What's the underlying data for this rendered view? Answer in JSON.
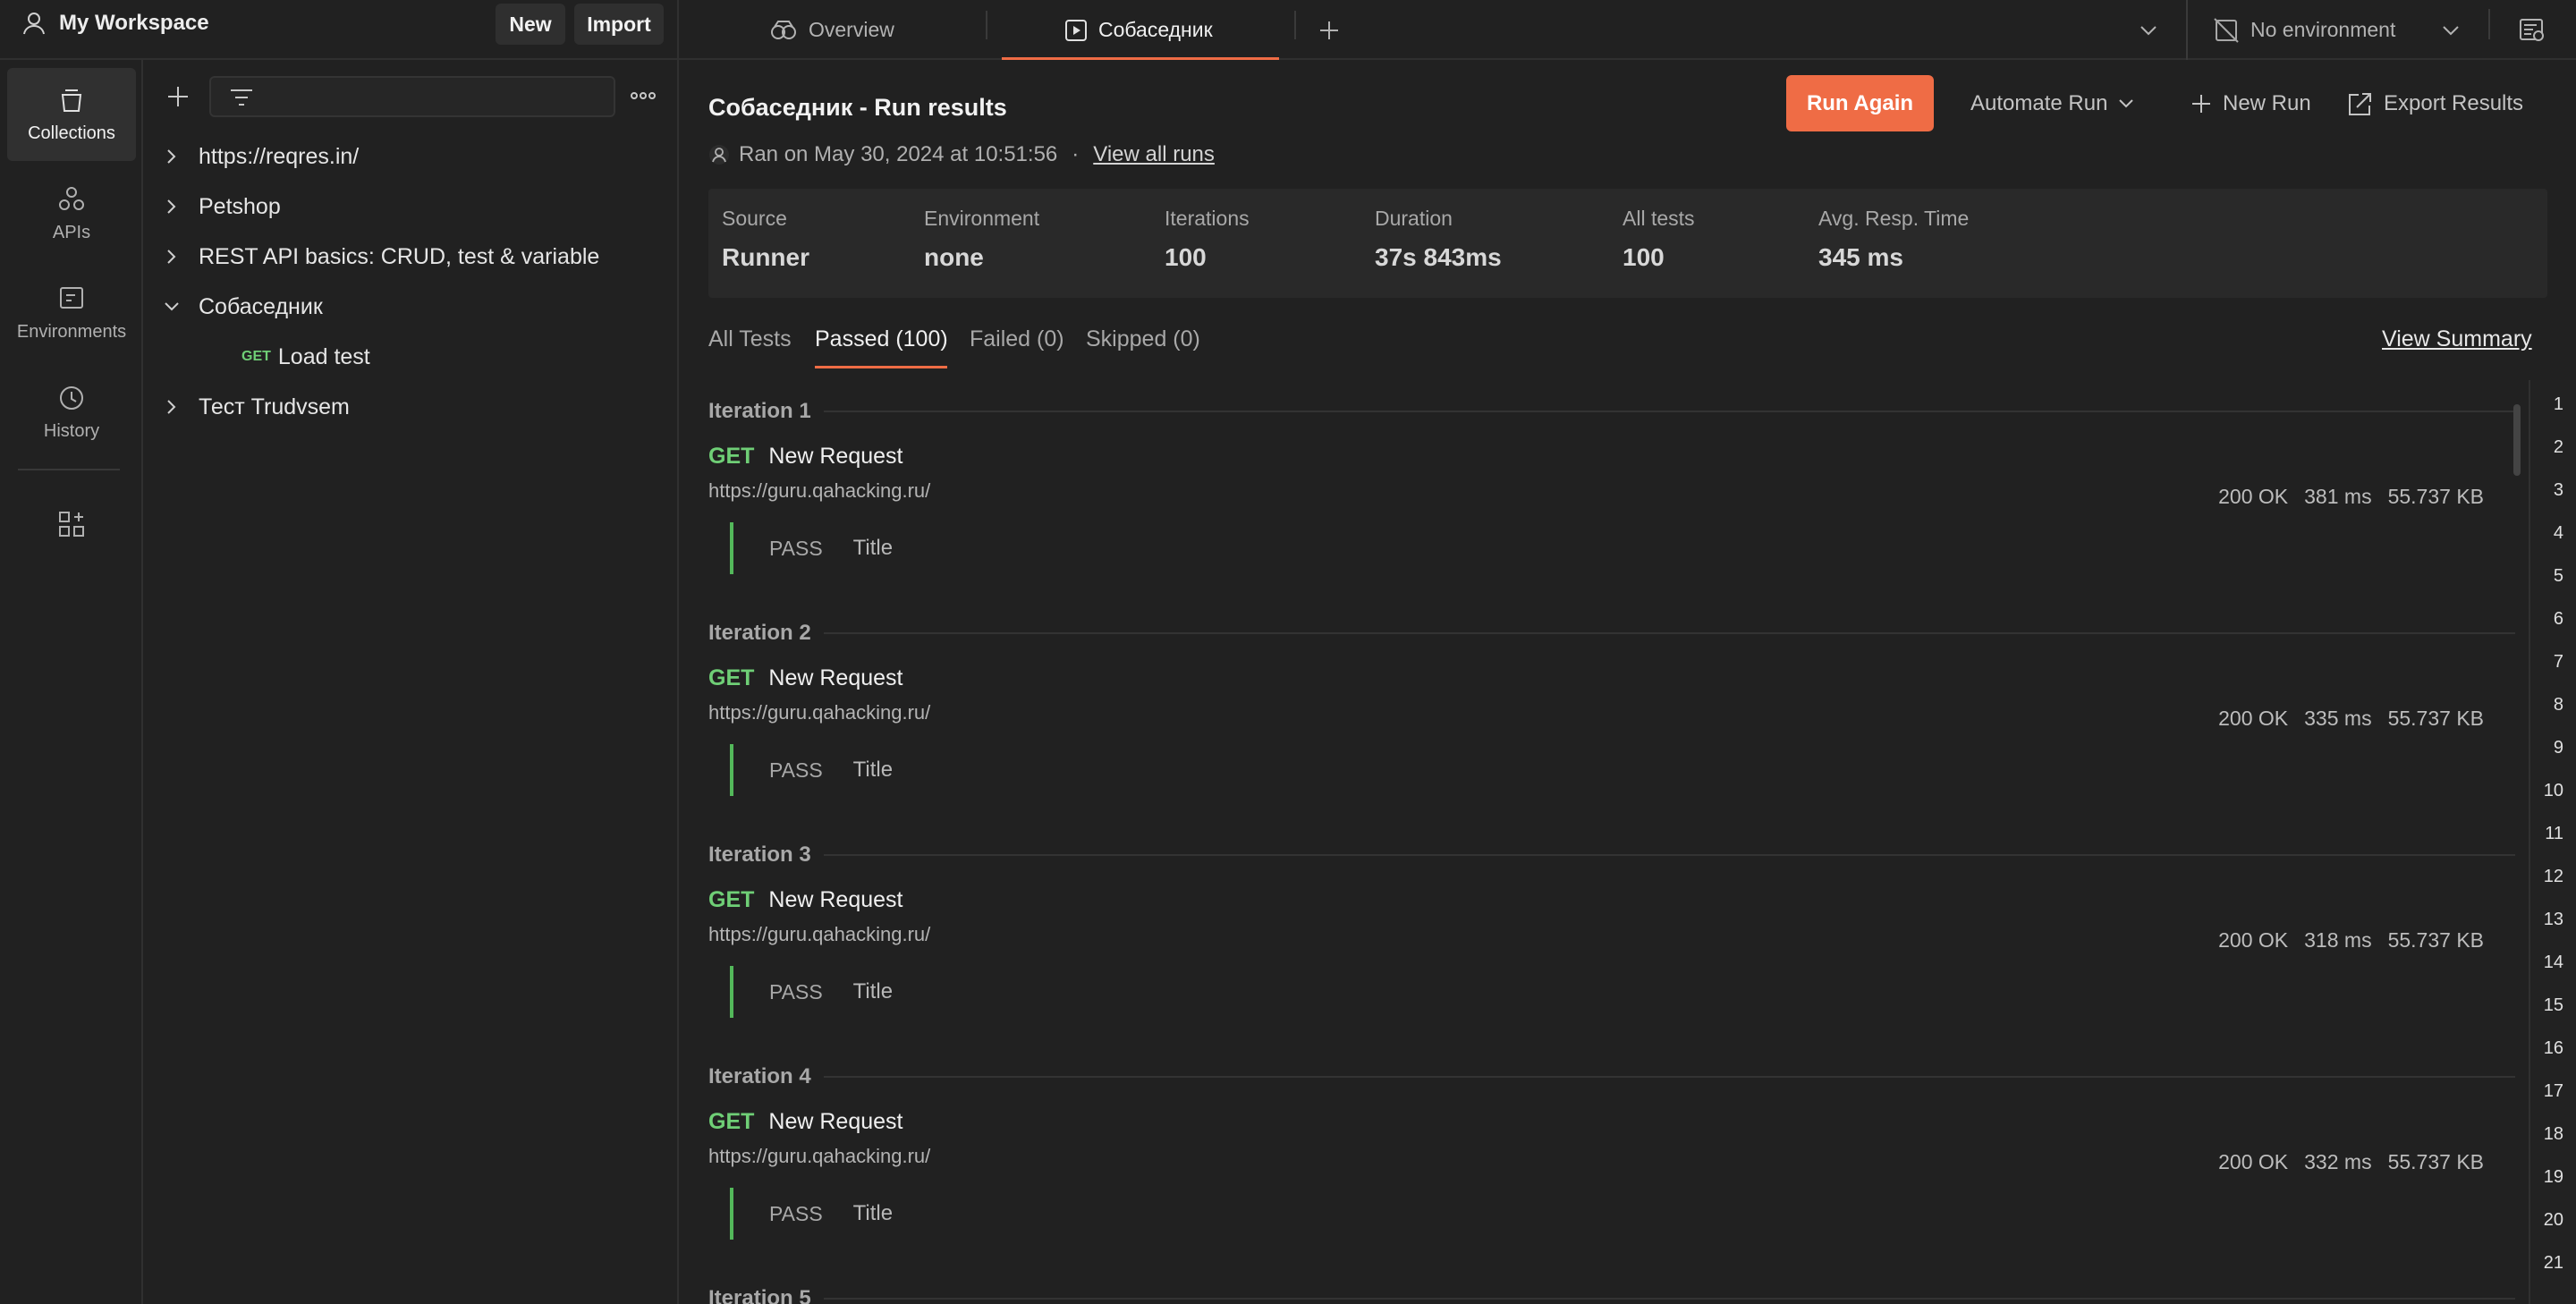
{
  "topbar": {
    "workspace": "My Workspace",
    "new_label": "New",
    "import_label": "Import",
    "tabs": [
      {
        "label": "Overview"
      },
      {
        "label": "Собаседник"
      }
    ],
    "environment": "No environment"
  },
  "rail": {
    "items": [
      {
        "label": "Collections",
        "icon": "collections-icon"
      },
      {
        "label": "APIs",
        "icon": "apis-icon"
      },
      {
        "label": "Environments",
        "icon": "environments-icon"
      },
      {
        "label": "History",
        "icon": "history-icon"
      }
    ]
  },
  "tree": {
    "items": [
      {
        "label": "https://reqres.in/"
      },
      {
        "label": "Petshop"
      },
      {
        "label": "REST API basics: CRUD, test & variable"
      },
      {
        "label": "Собаседник"
      },
      {
        "label": "Load test",
        "method": "GET"
      },
      {
        "label": "Тест Trudvsem"
      }
    ]
  },
  "main": {
    "title": "Собаседник - Run results",
    "ran_on": "Ran on May 30, 2024 at 10:51:56",
    "dot": "·",
    "view_all_runs": "View all runs",
    "run_again": "Run Again",
    "automate_run": "Automate Run",
    "new_run": "New Run",
    "export_results": "Export Results",
    "stats": [
      {
        "label": "Source",
        "value": "Runner"
      },
      {
        "label": "Environment",
        "value": "none"
      },
      {
        "label": "Iterations",
        "value": "100"
      },
      {
        "label": "Duration",
        "value": "37s 843ms"
      },
      {
        "label": "All tests",
        "value": "100"
      },
      {
        "label": "Avg. Resp. Time",
        "value": "345 ms"
      }
    ],
    "filter_tabs": [
      {
        "label": "All Tests"
      },
      {
        "label": "Passed (100)"
      },
      {
        "label": "Failed (0)"
      },
      {
        "label": "Skipped (0)"
      }
    ],
    "view_summary": "View Summary",
    "iterations": [
      {
        "title": "Iteration 1",
        "method": "GET",
        "name": "New Request",
        "url": "https://guru.qahacking.ru/",
        "status": "200 OK",
        "time": "381 ms",
        "size": "55.737 KB",
        "result": "PASS",
        "test": "Title"
      },
      {
        "title": "Iteration 2",
        "method": "GET",
        "name": "New Request",
        "url": "https://guru.qahacking.ru/",
        "status": "200 OK",
        "time": "335 ms",
        "size": "55.737 KB",
        "result": "PASS",
        "test": "Title"
      },
      {
        "title": "Iteration 3",
        "method": "GET",
        "name": "New Request",
        "url": "https://guru.qahacking.ru/",
        "status": "200 OK",
        "time": "318 ms",
        "size": "55.737 KB",
        "result": "PASS",
        "test": "Title"
      },
      {
        "title": "Iteration 4",
        "method": "GET",
        "name": "New Request",
        "url": "https://guru.qahacking.ru/",
        "status": "200 OK",
        "time": "332 ms",
        "size": "55.737 KB",
        "result": "PASS",
        "test": "Title"
      },
      {
        "title": "Iteration 5"
      }
    ],
    "gutter_numbers": [
      "1",
      "2",
      "3",
      "4",
      "5",
      "6",
      "7",
      "8",
      "9",
      "10",
      "11",
      "12",
      "13",
      "14",
      "15",
      "16",
      "17",
      "18",
      "19",
      "20",
      "21"
    ]
  },
  "colors": {
    "accent": "#ef6c45",
    "pass": "#53b85a",
    "get": "#6fcf76",
    "background": "#212121"
  }
}
